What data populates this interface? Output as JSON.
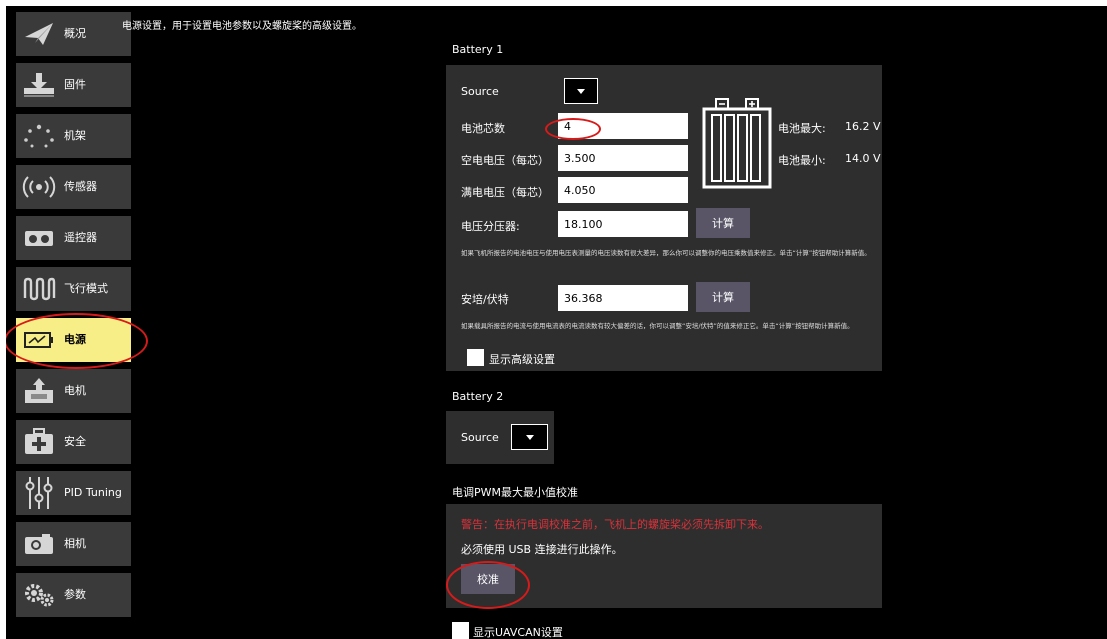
{
  "sidebar": {
    "items": [
      {
        "label": "概况",
        "icon": "paper-plane-icon"
      },
      {
        "label": "固件",
        "icon": "firmware-download-icon"
      },
      {
        "label": "机架",
        "icon": "airframe-dots-icon"
      },
      {
        "label": "传感器",
        "icon": "sensor-wave-icon"
      },
      {
        "label": "遥控器",
        "icon": "radio-controller-icon"
      },
      {
        "label": "飞行模式",
        "icon": "flight-modes-wave-icon"
      },
      {
        "label": "电源",
        "icon": "battery-power-icon"
      },
      {
        "label": "电机",
        "icon": "motor-icon"
      },
      {
        "label": "安全",
        "icon": "safety-medkit-icon"
      },
      {
        "label": "PID Tuning",
        "icon": "pid-sliders-icon"
      },
      {
        "label": "相机",
        "icon": "camera-icon"
      },
      {
        "label": "参数",
        "icon": "gears-icon"
      }
    ],
    "active_index": 6,
    "active_color": "#f8ee87"
  },
  "page": {
    "description": "电源设置，用于设置电池参数以及螺旋桨的高级设置。"
  },
  "battery1": {
    "title": "Battery 1",
    "source_label": "Source",
    "cells_label": "电池芯数",
    "cells_value": "4",
    "empty_label": "空电电压（每芯）",
    "empty_value": "3.500",
    "full_label": "满电电压（每芯）",
    "full_value": "4.050",
    "divider_label": "电压分压器:",
    "divider_value": "18.100",
    "calc_label": "计算",
    "divider_note": "如果飞机所报告的电池电压与使用电压表测量的电压读数有很大差异，那么你可以调整你的电压乘数值来修正。单击“计算”按钮帮助计算新值。",
    "amps_label": "安培/伏特",
    "amps_value": "36.368",
    "calc2_label": "计算",
    "amps_note": "如果载具所报告的电流与使用电流表的电流读数有较大偏差的话，你可以调整“安培/伏特”的值来修正它。单击“计算”按钮帮助计算新值。",
    "advanced_label": "显示高级设置",
    "max_label": "电池最大:",
    "max_value": "16.2 V",
    "min_label": "电池最小:",
    "min_value": "14.0 V"
  },
  "battery2": {
    "title": "Battery 2",
    "source_label": "Source"
  },
  "esc": {
    "title": "电调PWM最大最小值校准",
    "warning": "警告：在执行电调校准之前，飞机上的螺旋桨必须先拆卸下来。",
    "usb_note": "必须使用 USB 连接进行此操作。",
    "calibrate_label": "校准",
    "warning_color": "#d9323a"
  },
  "uavcan": {
    "label": "显示UAVCAN设置"
  }
}
